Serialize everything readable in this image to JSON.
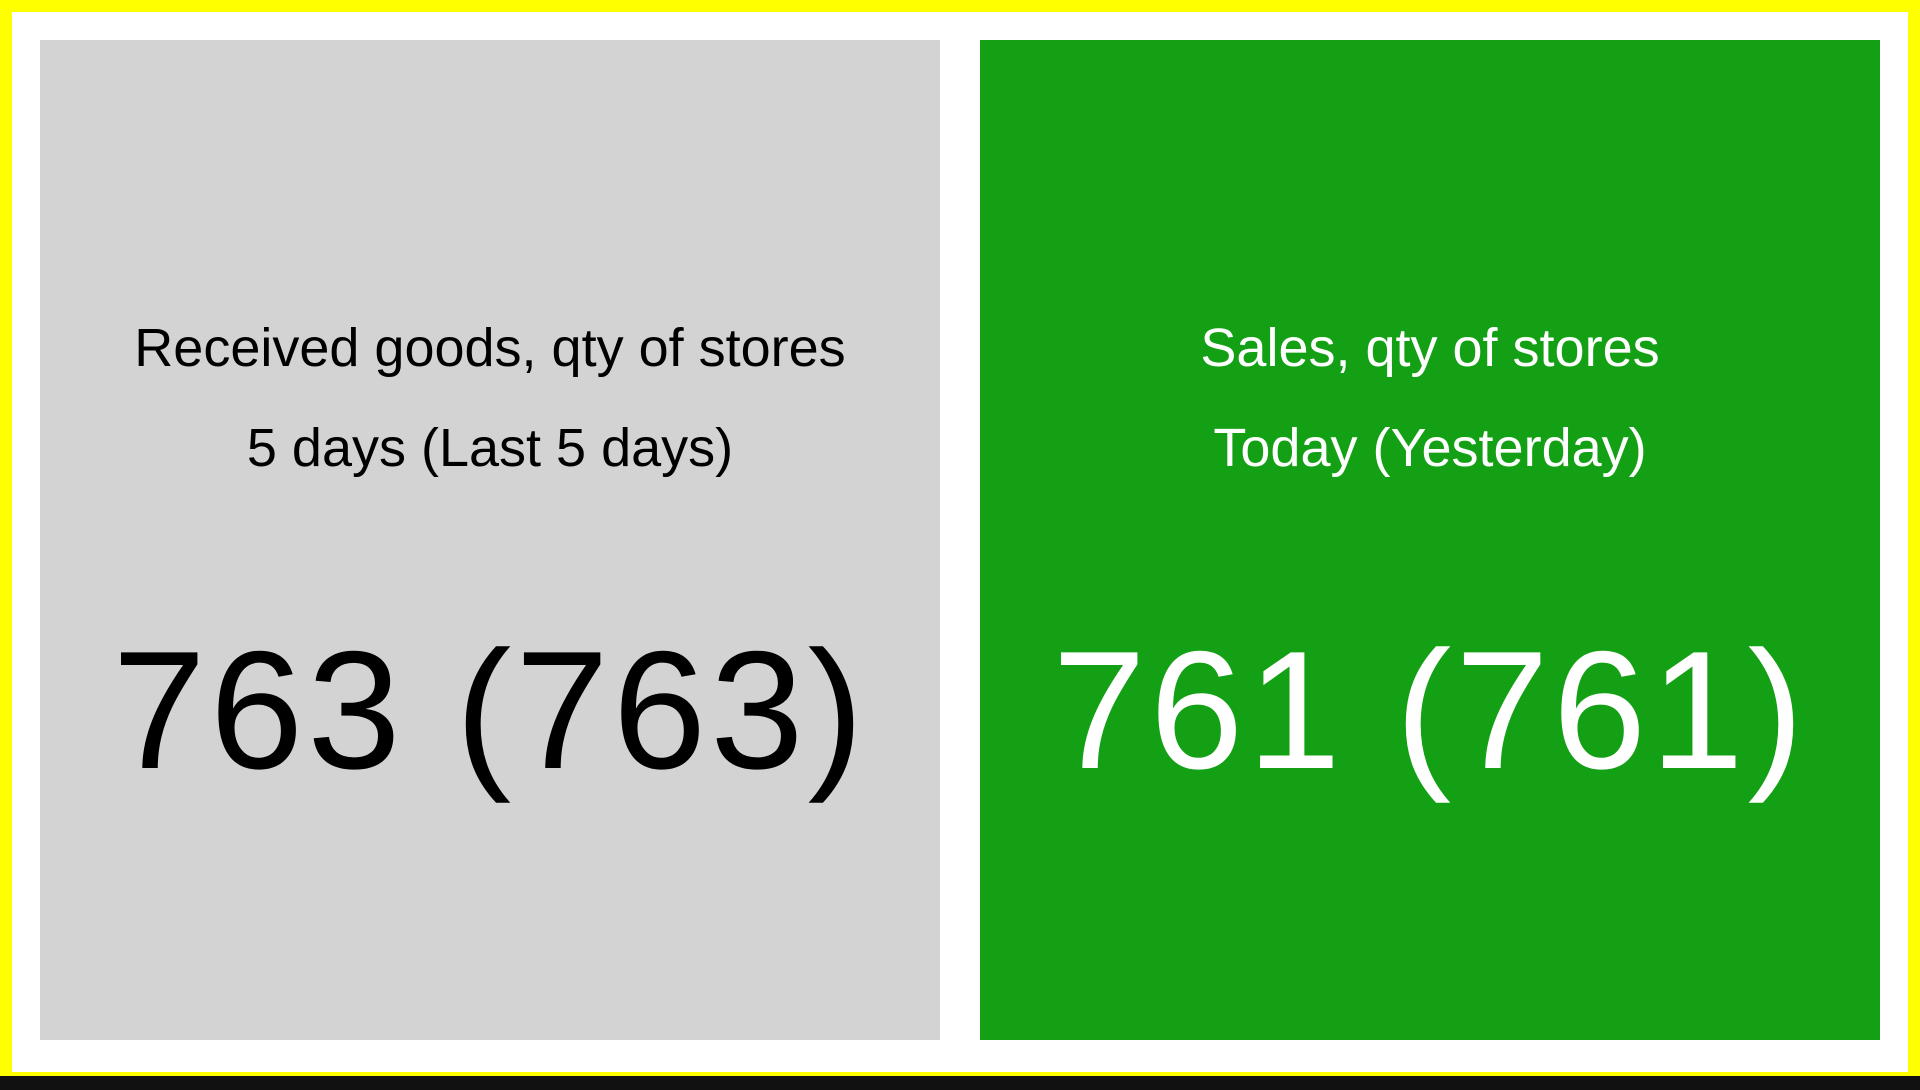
{
  "tiles": [
    {
      "title": "Received goods, qty of stores",
      "subtitle": "5 days (Last 5 days)",
      "value": "763 (763)",
      "background": "#d3d3d3",
      "text_color": "#000000"
    },
    {
      "title": "Sales, qty of stores",
      "subtitle": "Today (Yesterday)",
      "value": "761 (761)",
      "background": "#14a014",
      "text_color": "#ffffff"
    }
  ],
  "frame": {
    "border_color": "#ffff00",
    "inner_color": "#ffffff"
  }
}
